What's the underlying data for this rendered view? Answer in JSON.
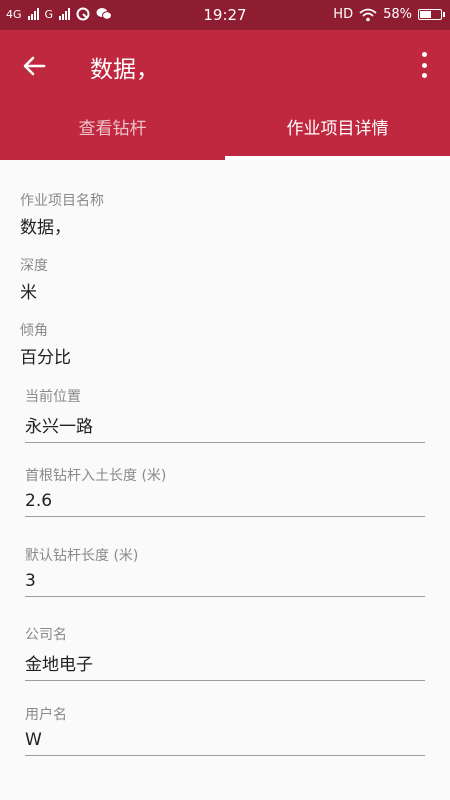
{
  "status_bar": {
    "network1": "4G",
    "network2": "G",
    "time": "19:27",
    "hd": "HD",
    "battery": "58%",
    "battery_level": 0.58
  },
  "app_bar": {
    "title": "数据，",
    "back_icon": "arrow-back-icon",
    "menu_icon": "more-vert-icon"
  },
  "tabs": [
    {
      "label": "查看钻杆",
      "active": false
    },
    {
      "label": "作业项目详情",
      "active": true
    }
  ],
  "readonly_fields": [
    {
      "label": "作业项目名称",
      "value": "数据，"
    },
    {
      "label": "深度",
      "value": "米"
    },
    {
      "label": "倾角",
      "value": "百分比"
    }
  ],
  "input_fields": [
    {
      "label": "当前位置",
      "value": "永兴一路"
    },
    {
      "label": "首根钻杆入土长度 (米)",
      "value": "2.6"
    },
    {
      "label": "默认钻杆长度 (米)",
      "value": "3"
    },
    {
      "label": "公司名",
      "value": "金地电子"
    },
    {
      "label": "用户名",
      "value": "W"
    }
  ],
  "colors": {
    "primary": "#c0283f",
    "status_bar": "#8f1d31",
    "background": "#fafafa"
  }
}
